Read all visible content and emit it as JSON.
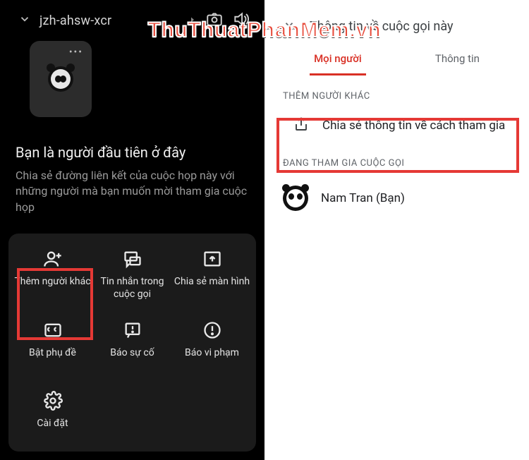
{
  "watermark": "ThuThuatPhanMem.vn",
  "left": {
    "meetId": "jzh-ahsw-xcr",
    "title": "Bạn là người đầu tiên ở đây",
    "subtitle": "Chia sẻ đường liên kết của cuộc họp này với những người mà bạn muốn mời tham gia cuộc họp",
    "grid": {
      "addOthers": "Thêm người khác",
      "inCallMessages": "Tin nhắn trong cuộc gọi",
      "shareScreen": "Chia sẻ màn hình",
      "captions": "Bật phụ đề",
      "reportProblem": "Báo sự cố",
      "reportAbuse": "Báo vi phạm",
      "settings": "Cài đặt"
    }
  },
  "right": {
    "headerTitle": "Thông tin về cuộc gọi này",
    "tabs": {
      "people": "Mọi người",
      "info": "Thông tin"
    },
    "sectionAdd": "THÊM NGƯỜI KHÁC",
    "shareJoining": "Chia sẻ thông tin về cách tham gia",
    "sectionParticipants": "ĐANG THAM GIA CUỘC GỌI",
    "participantName": "Nam Tran (Bạn)"
  }
}
